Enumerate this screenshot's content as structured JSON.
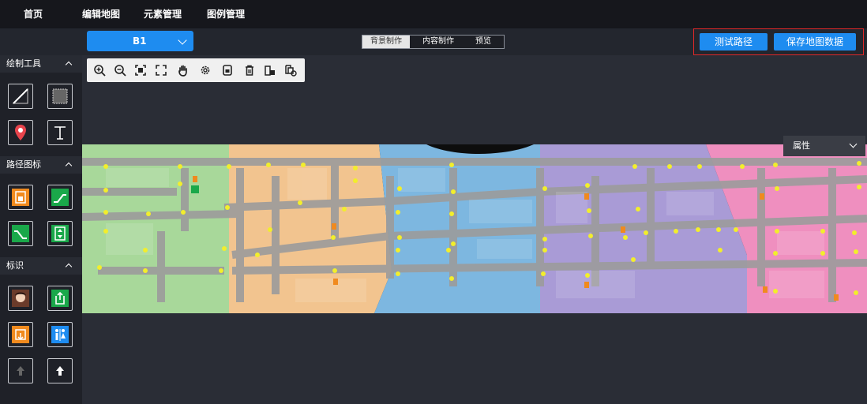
{
  "nav": {
    "items": [
      "首页",
      "编辑地图",
      "元素管理",
      "图例管理"
    ]
  },
  "floor": {
    "selected": "B1"
  },
  "mode_tabs": [
    "背景制作",
    "内容制作",
    "预览"
  ],
  "actions": {
    "test_path": "测试路径",
    "save_map": "保存地图数据"
  },
  "left_panel": {
    "draw_tools": {
      "title": "绘制工具"
    },
    "path_icons": {
      "title": "路径图标"
    },
    "markers": {
      "title": "标识"
    }
  },
  "toolbar_icons": [
    "zoom-in-icon",
    "zoom-out-icon",
    "fit-screen-icon",
    "fullscreen-icon",
    "hand-pan-icon",
    "settings-gear-icon",
    "lock-icon",
    "trash-icon",
    "paste-delete-icon",
    "copy-clear-icon"
  ],
  "properties": {
    "title": "属性"
  },
  "colors": {
    "accent": "#1e8cf0",
    "highlight_border": "#e02828",
    "zone_green": "#a8d89a",
    "zone_orange": "#f2c48f",
    "zone_blue": "#7db7e0",
    "zone_purple": "#a99bd6",
    "zone_pink": "#ef8fbf"
  }
}
